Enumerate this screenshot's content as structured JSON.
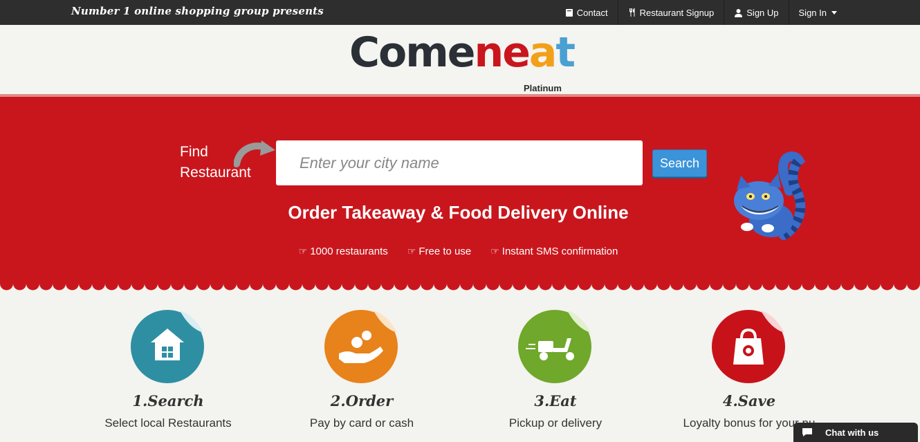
{
  "topbar": {
    "tagline": "Number 1 online shopping group presents",
    "nav": [
      {
        "label": "Contact",
        "icon": "book-icon"
      },
      {
        "label": "Restaurant Signup",
        "icon": "cutlery-icon"
      },
      {
        "label": "Sign Up",
        "icon": "user-icon"
      },
      {
        "label": "Sign In",
        "icon": "caret-down-icon"
      }
    ]
  },
  "logo": {
    "parts": [
      "Com",
      "e",
      "ne",
      "a",
      "t"
    ],
    "tier": "Platinum"
  },
  "hero": {
    "find_line1": "Find",
    "find_line2": "Restaurant",
    "search_placeholder": "Enter your city name",
    "search_button": "Search",
    "headline": "Order Takeaway & Food Delivery Online",
    "features": [
      "1000 restaurants",
      "Free to use",
      "Instant SMS confirmation"
    ]
  },
  "steps": [
    {
      "title": "1.Search",
      "desc": "Select local Restaurants",
      "color": "#2e8fa3",
      "icon": "house-icon"
    },
    {
      "title": "2.Order",
      "desc": "Pay by card or cash",
      "color": "#e8821a",
      "icon": "coin-hand-icon"
    },
    {
      "title": "3.Eat",
      "desc": "Pickup or delivery",
      "color": "#6fa82a",
      "icon": "scooter-icon"
    },
    {
      "title": "4.Save",
      "desc": "Loyalty bonus for your pu",
      "color": "#c8121a",
      "icon": "shopping-bag-icon"
    }
  ],
  "chat": {
    "label": "Chat with us"
  },
  "colors": {
    "hero_red": "#c9161d",
    "topbar": "#2e2e2e",
    "button_blue": "#3b94d9"
  }
}
